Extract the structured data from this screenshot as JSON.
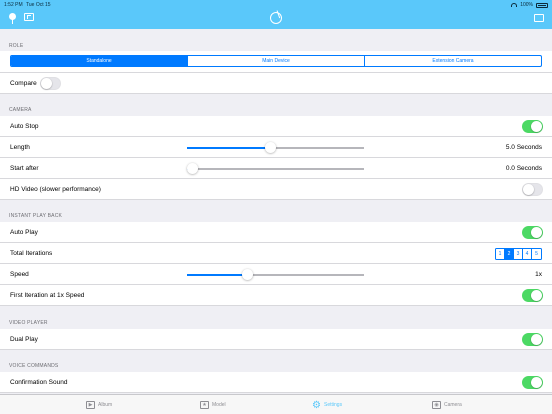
{
  "status": {
    "time": "1:52 PM",
    "date": "Tue Oct 15",
    "battery": "100%"
  },
  "header": {
    "icons": [
      "location-pin-icon",
      "picture-in-picture-icon",
      "app-logo-icon",
      "cast-icon"
    ],
    "color": "#5ac8fa"
  },
  "role": {
    "section": "ROLE",
    "options": [
      "Standalone",
      "Main Device",
      "Extension Camera"
    ],
    "selected_index": 0,
    "compare_label": "Compare",
    "compare_on": false
  },
  "camera": {
    "section": "CAMERA",
    "auto_stop_label": "Auto Stop",
    "auto_stop_on": true,
    "length_label": "Length",
    "length_value": "5.0 Seconds",
    "length_fraction": 0.47,
    "start_after_label": "Start after",
    "start_after_value": "0.0 Seconds",
    "start_after_fraction": 0.03,
    "hd_label": "HD Video (slower performance)",
    "hd_on": false
  },
  "instant": {
    "section": "INSTANT PLAY BACK",
    "auto_play_label": "Auto Play",
    "auto_play_on": true,
    "iterations_label": "Total Iterations",
    "iterations": [
      "1",
      "2",
      "3",
      "4",
      "5"
    ],
    "iterations_selected": 1,
    "speed_label": "Speed",
    "speed_value": "1x",
    "speed_fraction": 0.34,
    "first_iter_label": "First Iteration at 1x Speed",
    "first_iter_on": true
  },
  "video_player": {
    "section": "VIDEO PLAYER",
    "dual_play_label": "Dual Play",
    "dual_play_on": true
  },
  "voice": {
    "section": "VOICE COMMANDS",
    "confirm_label": "Confirmation Sound",
    "confirm_on": true
  },
  "tabs": [
    {
      "label": "Album",
      "icon": "play-icon"
    },
    {
      "label": "Model",
      "icon": "star-icon"
    },
    {
      "label": "Settings",
      "icon": "gear-icon"
    },
    {
      "label": "Camera",
      "icon": "camera-icon"
    }
  ],
  "colors": {
    "accent": "#007aff",
    "toggle_on": "#4cd964",
    "tab_active": "#5ac8fa"
  }
}
